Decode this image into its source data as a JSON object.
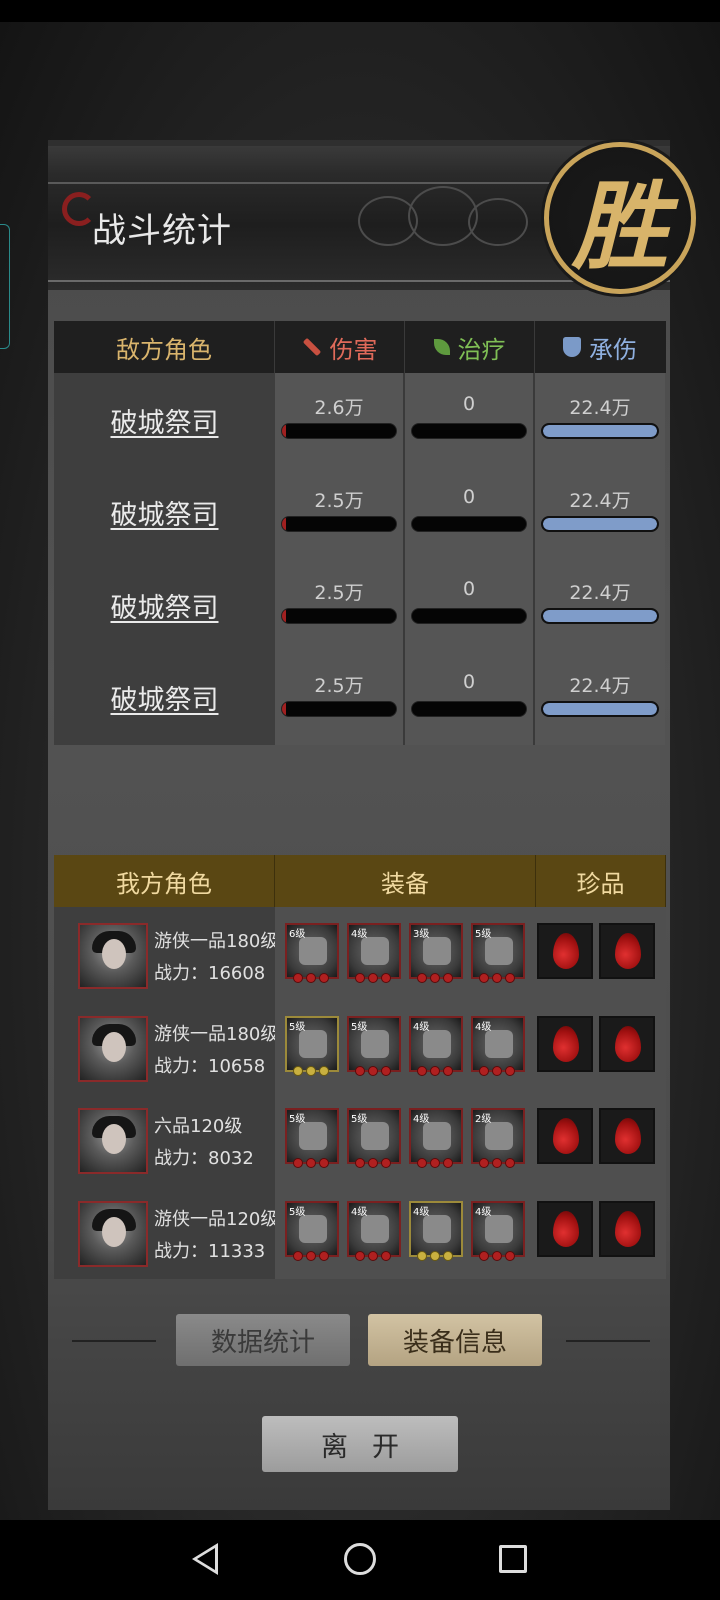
{
  "header": {
    "title": "战斗统计",
    "badge": "胜"
  },
  "enemy_table": {
    "headers": {
      "role": "敌方角色",
      "damage": "伤害",
      "heal": "治疗",
      "taken": "承伤"
    },
    "rows": [
      {
        "name": "破城祭司",
        "damage": "2.6万",
        "damage_fraction": 0.02,
        "heal": "0",
        "heal_fraction": 0,
        "taken": "22.4万",
        "taken_fraction": 1.0
      },
      {
        "name": "破城祭司",
        "damage": "2.5万",
        "damage_fraction": 0.02,
        "heal": "0",
        "heal_fraction": 0,
        "taken": "22.4万",
        "taken_fraction": 1.0
      },
      {
        "name": "破城祭司",
        "damage": "2.5万",
        "damage_fraction": 0.02,
        "heal": "0",
        "heal_fraction": 0,
        "taken": "22.4万",
        "taken_fraction": 1.0
      },
      {
        "name": "破城祭司",
        "damage": "2.5万",
        "damage_fraction": 0.02,
        "heal": "0",
        "heal_fraction": 0,
        "taken": "22.4万",
        "taken_fraction": 1.0
      }
    ]
  },
  "ally_table": {
    "headers": {
      "role": "我方角色",
      "equipment": "装备",
      "treasure": "珍品"
    },
    "rows": [
      {
        "rank": "游侠一品180级",
        "power_label": "战力：",
        "power": "16608",
        "equipment": [
          {
            "level": "6级",
            "tier": "red"
          },
          {
            "level": "4级",
            "tier": "red"
          },
          {
            "level": "3级",
            "tier": "red"
          },
          {
            "level": "5级",
            "tier": "red"
          }
        ]
      },
      {
        "rank": "游侠一品180级",
        "power_label": "战力：",
        "power": "10658",
        "equipment": [
          {
            "level": "5级",
            "tier": "gold"
          },
          {
            "level": "5级",
            "tier": "red"
          },
          {
            "level": "4级",
            "tier": "red"
          },
          {
            "level": "4级",
            "tier": "red"
          }
        ]
      },
      {
        "rank": "六品120级",
        "power_label": "战力：",
        "power": "8032",
        "equipment": [
          {
            "level": "5级",
            "tier": "red"
          },
          {
            "level": "5级",
            "tier": "red"
          },
          {
            "level": "4级",
            "tier": "red"
          },
          {
            "level": "2级",
            "tier": "red"
          }
        ]
      },
      {
        "rank": "游侠一品120级",
        "power_label": "战力：",
        "power": "11333",
        "equipment": [
          {
            "level": "5级",
            "tier": "red"
          },
          {
            "level": "4级",
            "tier": "red"
          },
          {
            "level": "4级",
            "tier": "gold"
          },
          {
            "level": "4级",
            "tier": "red"
          }
        ]
      }
    ]
  },
  "buttons": {
    "stats": "数据统计",
    "equipment_info": "装备信息",
    "leave": "离开"
  },
  "colors": {
    "accent_gold": "#d8b46a",
    "damage_red": "#a02020",
    "taken_blue": "#7f9cc9",
    "ally_header": "#5a4713"
  }
}
